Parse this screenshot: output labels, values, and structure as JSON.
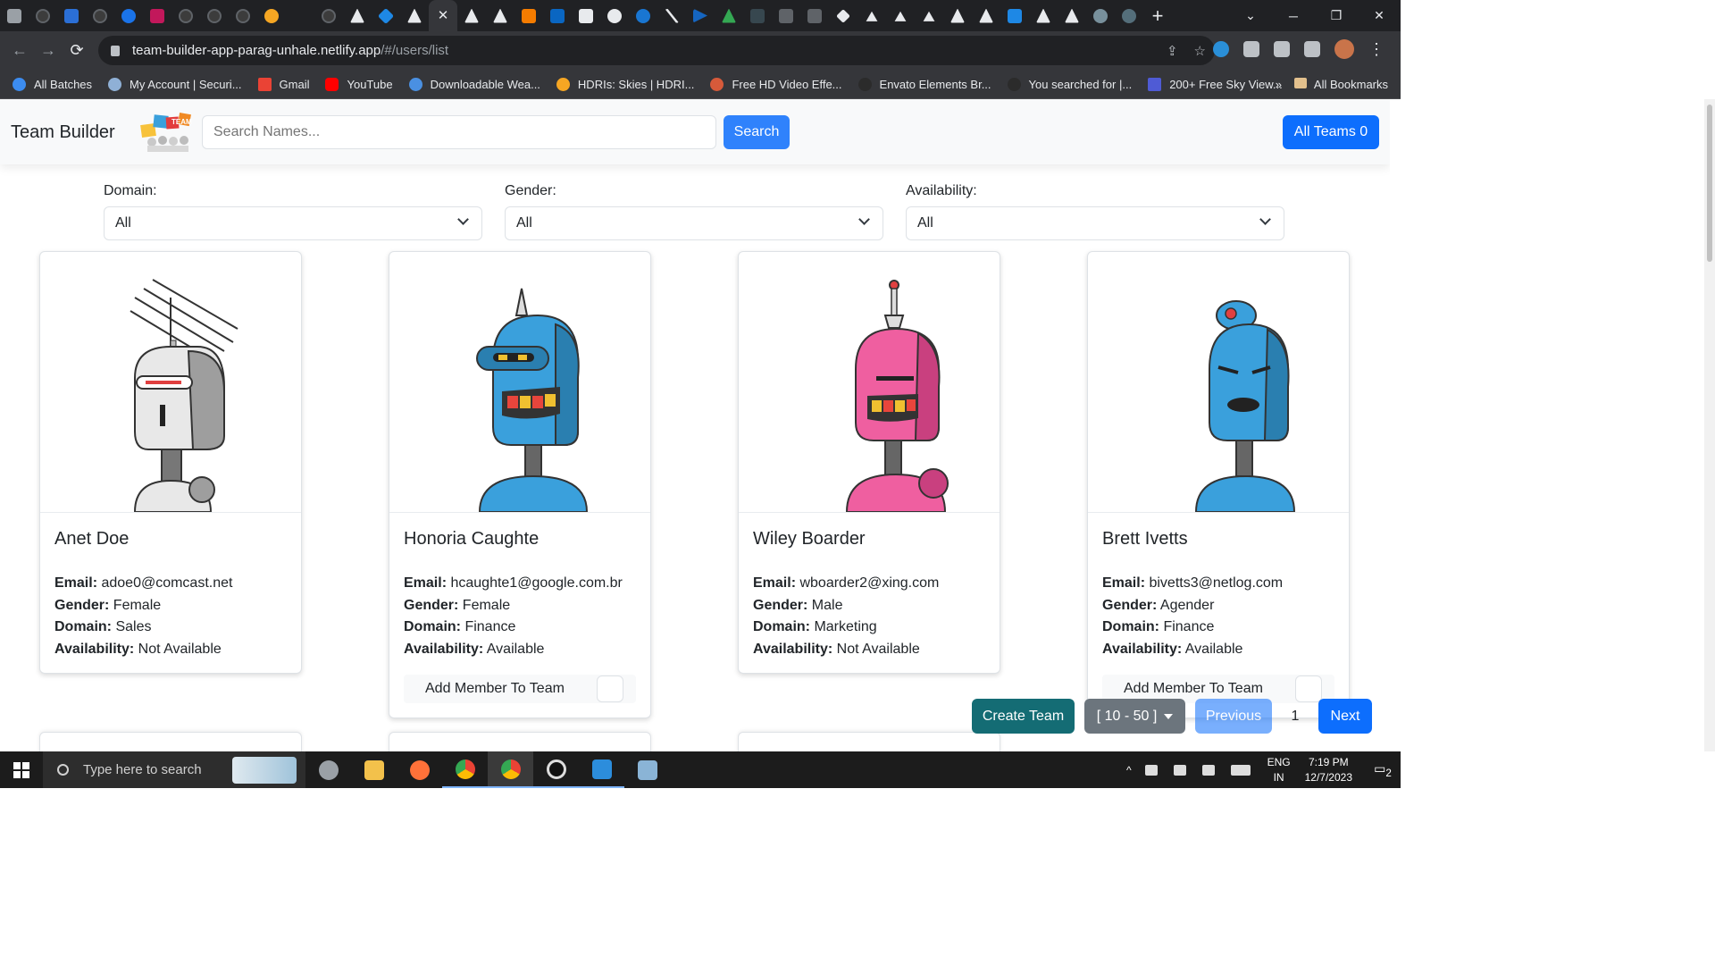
{
  "browser": {
    "active_tab_close": "✕",
    "new_tab": "+",
    "window_controls": {
      "minimize": "─",
      "restore": "❐",
      "close": "✕"
    },
    "nav": {
      "back": "←",
      "forward": "→",
      "reload": "⟳"
    },
    "url_host": "team-builder-app-parag-unhale.netlify.app",
    "url_path": "/#/users/list",
    "omnibox_icons": {
      "share": "⇪",
      "star": "☆"
    },
    "more_menu": "⋮",
    "bookmarks": [
      {
        "label": "All Batches",
        "color": "#3c8cf0"
      },
      {
        "label": "My Account | Securi...",
        "color": "#8fb0d6"
      },
      {
        "label": "Gmail",
        "color": "#ea4335"
      },
      {
        "label": "YouTube",
        "color": "#ff0000"
      },
      {
        "label": "Downloadable Wea...",
        "color": "#4a90e2"
      },
      {
        "label": "HDRIs: Skies | HDRI...",
        "color": "#f6a623"
      },
      {
        "label": "Free HD Video Effe...",
        "color": "#d65a3a"
      },
      {
        "label": "Envato Elements Br...",
        "color": "#2b2b2b"
      },
      {
        "label": "You searched for |...",
        "color": "#2b2b2b"
      },
      {
        "label": "200+ Free Sky View...",
        "color": "#4f5bd5"
      }
    ],
    "bookmarks_overflow": "»",
    "all_bookmarks": "All Bookmarks"
  },
  "app": {
    "brand": "Team Builder",
    "logo_text": "TEAM",
    "search_placeholder": "Search Names...",
    "search_button": "Search",
    "all_teams_button": "All Teams 0",
    "colors": {
      "primary": "#0d6efd",
      "create": "#146c74",
      "secondary": "#6c757d"
    }
  },
  "filters": [
    {
      "label": "Domain:",
      "value": "All"
    },
    {
      "label": "Gender:",
      "value": "All"
    },
    {
      "label": "Availability:",
      "value": "All"
    }
  ],
  "field_labels": {
    "email": "Email:",
    "gender": "Gender:",
    "domain": "Domain:",
    "availability": "Availability:"
  },
  "add_member_label": "Add Member To Team",
  "users": [
    {
      "name": "Anet Doe",
      "email": "adoe0@comcast.net",
      "gender": "Female",
      "domain": "Sales",
      "availability": "Not Available",
      "avatar_color": "#e6e6e6",
      "show_add": false
    },
    {
      "name": "Honoria Caughte",
      "email": "hcaughte1@google.com.br",
      "gender": "Female",
      "domain": "Finance",
      "availability": "Available",
      "avatar_color": "#3aa0dc",
      "show_add": true
    },
    {
      "name": "Wiley Boarder",
      "email": "wboarder2@xing.com",
      "gender": "Male",
      "domain": "Marketing",
      "availability": "Not Available",
      "avatar_color": "#ef5fa0",
      "show_add": false
    },
    {
      "name": "Brett Ivetts",
      "email": "bivetts3@netlog.com",
      "gender": "Agender",
      "domain": "Finance",
      "availability": "Available",
      "avatar_color": "#3aa0dc",
      "show_add": true
    }
  ],
  "pager": {
    "create_team": "Create Team",
    "range": "[ 10 - 50 ]",
    "previous": "Previous",
    "page": "1",
    "next": "Next"
  },
  "taskbar": {
    "search_placeholder": "Type here to search",
    "apps": [
      {
        "name": "settings",
        "color": "#9aa0a6"
      },
      {
        "name": "file-explorer",
        "color": "#f3c14b"
      },
      {
        "name": "firefox",
        "color": "#ff7139"
      },
      {
        "name": "chrome",
        "color": "#e0483e"
      },
      {
        "name": "chrome-profile",
        "color": "#e0483e"
      },
      {
        "name": "obs",
        "color": "#3a3a3a"
      },
      {
        "name": "vscode",
        "color": "#2c8ddc"
      },
      {
        "name": "notepad",
        "color": "#8ab4d6"
      }
    ],
    "tray_arrow": "^",
    "lang_top": "ENG",
    "lang_bottom": "IN",
    "time": "7:19 PM",
    "date": "12/7/2023",
    "notifications": "2"
  }
}
